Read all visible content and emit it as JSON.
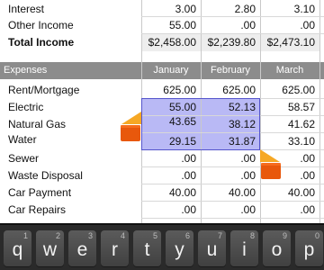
{
  "colors": {
    "header_bg": "#8c8c8c",
    "selection": "#b9b9f5",
    "handle_orange": "#e8580c",
    "handle_yellow": "#f6a825",
    "keyboard_bg": "#2a2a2a"
  },
  "income": {
    "rows": [
      {
        "label": "Interest",
        "values": [
          "3.00",
          "2.80",
          "3.10"
        ]
      },
      {
        "label": "Other Income",
        "values": [
          "55.00",
          ".00",
          ".00"
        ]
      }
    ],
    "total": {
      "label": "Total Income",
      "values": [
        "$2,458.00",
        "$2,239.80",
        "$2,473.10"
      ]
    }
  },
  "expenses": {
    "header": "Expenses",
    "columns": [
      "January",
      "February",
      "March"
    ],
    "rows": [
      {
        "label": "Rent/Mortgage",
        "values": [
          "625.00",
          "625.00",
          "625.00"
        ]
      },
      {
        "label": "Electric",
        "values": [
          "55.00",
          "52.13",
          "58.57"
        ]
      },
      {
        "label": "Natural Gas",
        "values": [
          "43.65",
          "38.12",
          "41.62"
        ]
      },
      {
        "label": "Water",
        "values": [
          "29.15",
          "31.87",
          "33.10"
        ]
      },
      {
        "label": "Sewer",
        "values": [
          ".00",
          ".00",
          ".00"
        ]
      },
      {
        "label": "Waste Disposal",
        "values": [
          ".00",
          ".00",
          ".00"
        ]
      },
      {
        "label": "Car Payment",
        "values": [
          "40.00",
          "40.00",
          "40.00"
        ]
      },
      {
        "label": "Car Repairs",
        "values": [
          ".00",
          ".00",
          ".00"
        ]
      }
    ]
  },
  "keyboard": {
    "keys": [
      {
        "char": "q",
        "alt": "1"
      },
      {
        "char": "w",
        "alt": "2"
      },
      {
        "char": "e",
        "alt": "3"
      },
      {
        "char": "r",
        "alt": "4"
      },
      {
        "char": "t",
        "alt": "5"
      },
      {
        "char": "y",
        "alt": "6"
      },
      {
        "char": "u",
        "alt": "7"
      },
      {
        "char": "i",
        "alt": "8"
      },
      {
        "char": "o",
        "alt": "9"
      },
      {
        "char": "p",
        "alt": "0"
      }
    ]
  }
}
